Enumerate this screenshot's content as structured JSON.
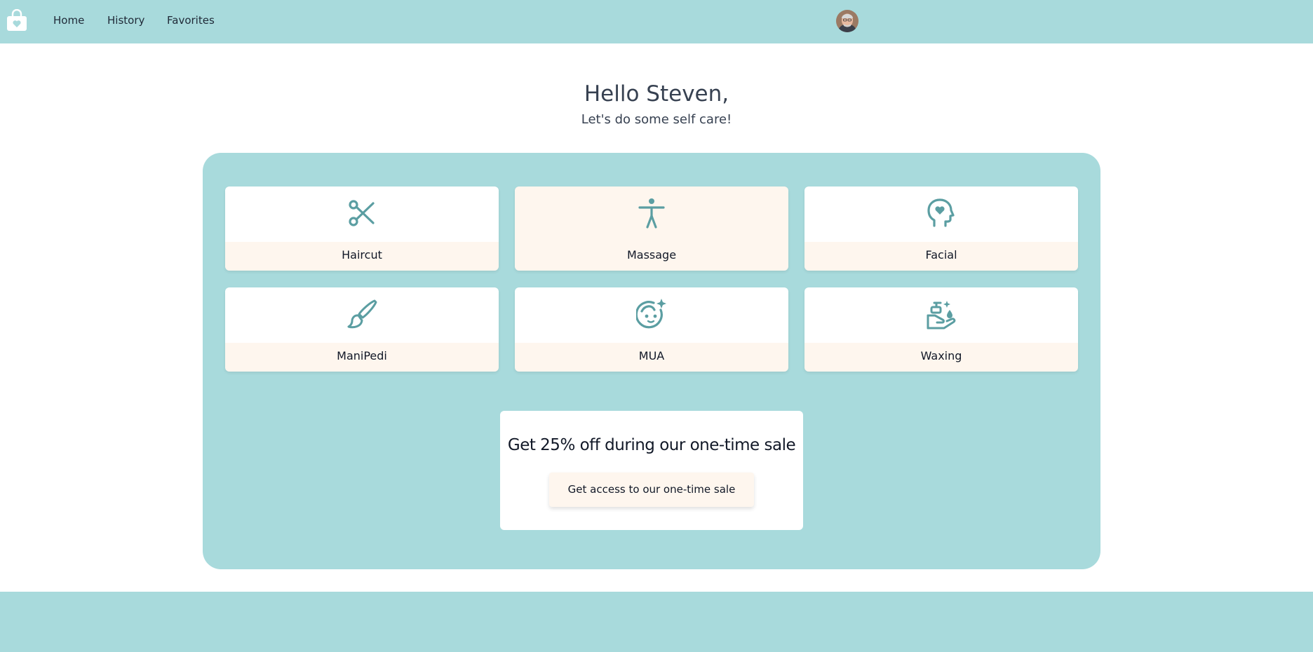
{
  "header": {
    "logo_icon": "shopping-bag-heart-icon",
    "nav": [
      {
        "label": "Home"
      },
      {
        "label": "History"
      },
      {
        "label": "Favorites"
      }
    ],
    "avatar_icon": "user-avatar"
  },
  "greeting": {
    "title": "Hello Steven,",
    "subtitle": "Let's do some self care!"
  },
  "services": [
    {
      "label": "Haircut",
      "icon": "scissors-icon"
    },
    {
      "label": "Massage",
      "icon": "person-standing-icon"
    },
    {
      "label": "Facial",
      "icon": "head-heart-icon"
    },
    {
      "label": "ManiPedi",
      "icon": "paintbrush-icon"
    },
    {
      "label": "MUA",
      "icon": "sparkle-face-icon"
    },
    {
      "label": "Waxing",
      "icon": "soap-hand-icon"
    }
  ],
  "promo": {
    "title": "Get 25% off during our one-time sale",
    "button_label": "Get access to our one-time sale"
  },
  "colors": {
    "primary": "#a8dadc",
    "cream": "#fef6ee",
    "icon": "#5b9ea2",
    "text": "#1f2937"
  }
}
